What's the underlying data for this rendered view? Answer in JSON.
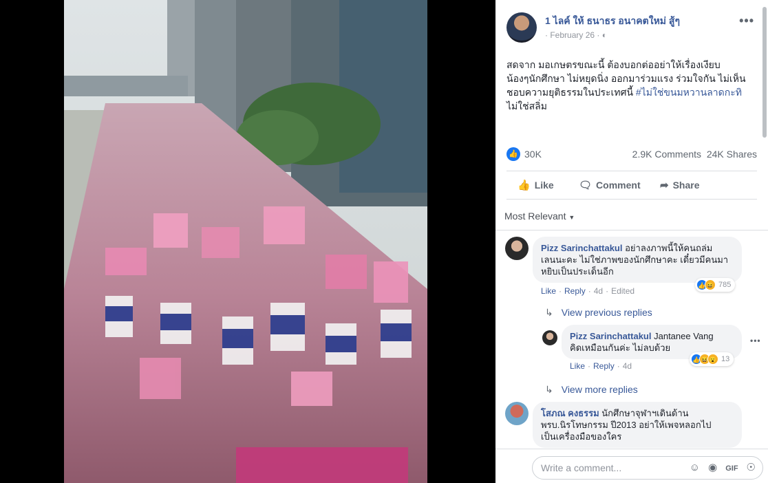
{
  "post": {
    "author": "1 ไลค์ ให้ ธนาธร อนาคตใหม่ สู้ๆ",
    "date": "February 26",
    "privacy_icon": "globe-icon",
    "text_line1": "สดจาก มอเกษตรขณะนี้ ต้องบอกต่ออย่าให้เรื่องเงียบ",
    "text_line2": "น้องๆนักศึกษา ไม่หยุดนิ่ง ออกมาร่วมแรง ร่วมใจกัน ไม่เห็น",
    "text_line3_plain": "ชอบความยุติธรรมในประเทศนี้ ",
    "hashtag": "#ไม่ใช่ขนมหวานลาดกะทิ",
    "text_line4": "ไม่ใช่สลิ่ม",
    "like_count": "30K",
    "comments_count": "2.9K Comments",
    "shares_count": "24K Shares"
  },
  "actions": {
    "like": "Like",
    "comment": "Comment",
    "share": "Share"
  },
  "sort_label": "Most Relevant",
  "comments": [
    {
      "name": "Pizz Sarinchattakul",
      "text1": "อย่าลงภาพนี้ให้คนถล่ม",
      "text2": "เลนนะคะ ไม่ใช่ภาพของนักศึกษาคะ เดี๋ยวมีคนมา",
      "text3": "หยิบเป็นประเด็นอีก",
      "like": "Like",
      "reply": "Reply",
      "time": "4d",
      "edited": "Edited",
      "reactions": "785"
    }
  ],
  "view_previous_replies": "View previous replies",
  "reply": {
    "name": "Pizz Sarinchattakul",
    "mention": "Jantanee Vang",
    "text2": "คิดเหมือนกันค่ะ ไม่ลบด้วย",
    "like": "Like",
    "reply": "Reply",
    "time": "4d",
    "reactions": "13"
  },
  "view_more_replies": "View more replies",
  "comment2": {
    "name": "โสภณ คงธรรม",
    "text1": "นักศึกษาจุฬาฯเดินด้าน",
    "text2": "พรบ.นิรโทษกรรม ปี2013 อย่าให้เพจหลอกไป",
    "text3": "เป็นเครื่องมือของใคร"
  },
  "compose": {
    "placeholder": "Write a comment..."
  },
  "colors": {
    "link": "#385898",
    "like_blue": "#1877f2"
  }
}
